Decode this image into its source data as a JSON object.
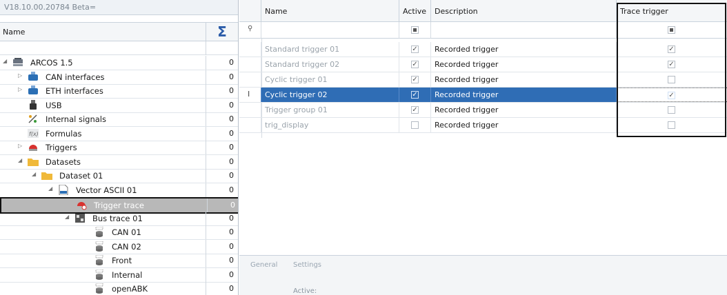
{
  "left": {
    "version": "V18.10.00.20784 Beta=",
    "header_name": "Name",
    "header_sum_icon": "sigma-icon",
    "rows": [
      {
        "label": "ARCOS 1.5",
        "count": "0",
        "indent": 0,
        "arrow": "open",
        "icon": "database-icon"
      },
      {
        "label": "CAN interfaces",
        "count": "0",
        "indent": 1,
        "arrow": "closed",
        "icon": "can-icon"
      },
      {
        "label": "ETH interfaces",
        "count": "0",
        "indent": 1,
        "arrow": "closed",
        "icon": "eth-icon"
      },
      {
        "label": "USB",
        "count": "0",
        "indent": 1,
        "arrow": "none",
        "icon": "usb-icon"
      },
      {
        "label": "Internal signals",
        "count": "0",
        "indent": 1,
        "arrow": "none",
        "icon": "signals-icon"
      },
      {
        "label": "Formulas",
        "count": "0",
        "indent": 1,
        "arrow": "none",
        "icon": "formula-icon"
      },
      {
        "label": "Triggers",
        "count": "0",
        "indent": 1,
        "arrow": "closed",
        "icon": "trigger-icon"
      },
      {
        "label": "Datasets",
        "count": "0",
        "indent": 1,
        "arrow": "open",
        "icon": "folder-icon"
      },
      {
        "label": "Dataset 01",
        "count": "0",
        "indent": 2,
        "arrow": "open",
        "icon": "folder-icon"
      },
      {
        "label": "Vector ASCII 01",
        "count": "0",
        "indent": 3,
        "arrow": "open",
        "icon": "file-icon"
      },
      {
        "label": "Trigger trace",
        "count": "0",
        "indent": 4,
        "arrow": "none",
        "icon": "trigger-trace-icon",
        "selected": true
      },
      {
        "label": "Bus trace 01",
        "count": "0",
        "indent": 4,
        "arrow": "open",
        "icon": "bus-trace-icon"
      },
      {
        "label": "CAN 01",
        "count": "0",
        "indent": 5,
        "arrow": "none",
        "icon": "channel-icon"
      },
      {
        "label": "CAN 02",
        "count": "0",
        "indent": 5,
        "arrow": "none",
        "icon": "channel-icon"
      },
      {
        "label": "Front",
        "count": "0",
        "indent": 5,
        "arrow": "none",
        "icon": "channel-icon"
      },
      {
        "label": "Internal",
        "count": "0",
        "indent": 5,
        "arrow": "none",
        "icon": "channel-icon"
      },
      {
        "label": "openABK",
        "count": "0",
        "indent": 5,
        "arrow": "none",
        "icon": "channel-icon"
      }
    ]
  },
  "grid": {
    "headers": {
      "name": "Name",
      "active": "Active",
      "description": "Description",
      "trace": "Trace trigger"
    },
    "filter_icon": "pin-icon",
    "row_cursor": "I",
    "rows": [
      {
        "name": "Standard trigger 01",
        "active": true,
        "description": "Recorded trigger",
        "trace": true
      },
      {
        "name": "Standard trigger 02",
        "active": true,
        "description": "Recorded trigger",
        "trace": true
      },
      {
        "name": "Cyclic trigger 01",
        "active": true,
        "description": "Recorded trigger",
        "trace": false
      },
      {
        "name": "Cyclic trigger 02",
        "active": true,
        "description": "Recorded trigger",
        "trace": true,
        "selected": true
      },
      {
        "name": "Trigger group 01",
        "active": true,
        "description": "Recorded trigger",
        "trace": false
      },
      {
        "name": "trig_display",
        "active": false,
        "description": "Recorded trigger",
        "trace": false
      }
    ]
  },
  "lower": {
    "tab_general": "General",
    "tab_settings": "Settings",
    "active_label": "Active:"
  },
  "colors": {
    "selection": "#2f6db5",
    "accent": "#2a5ba8"
  }
}
